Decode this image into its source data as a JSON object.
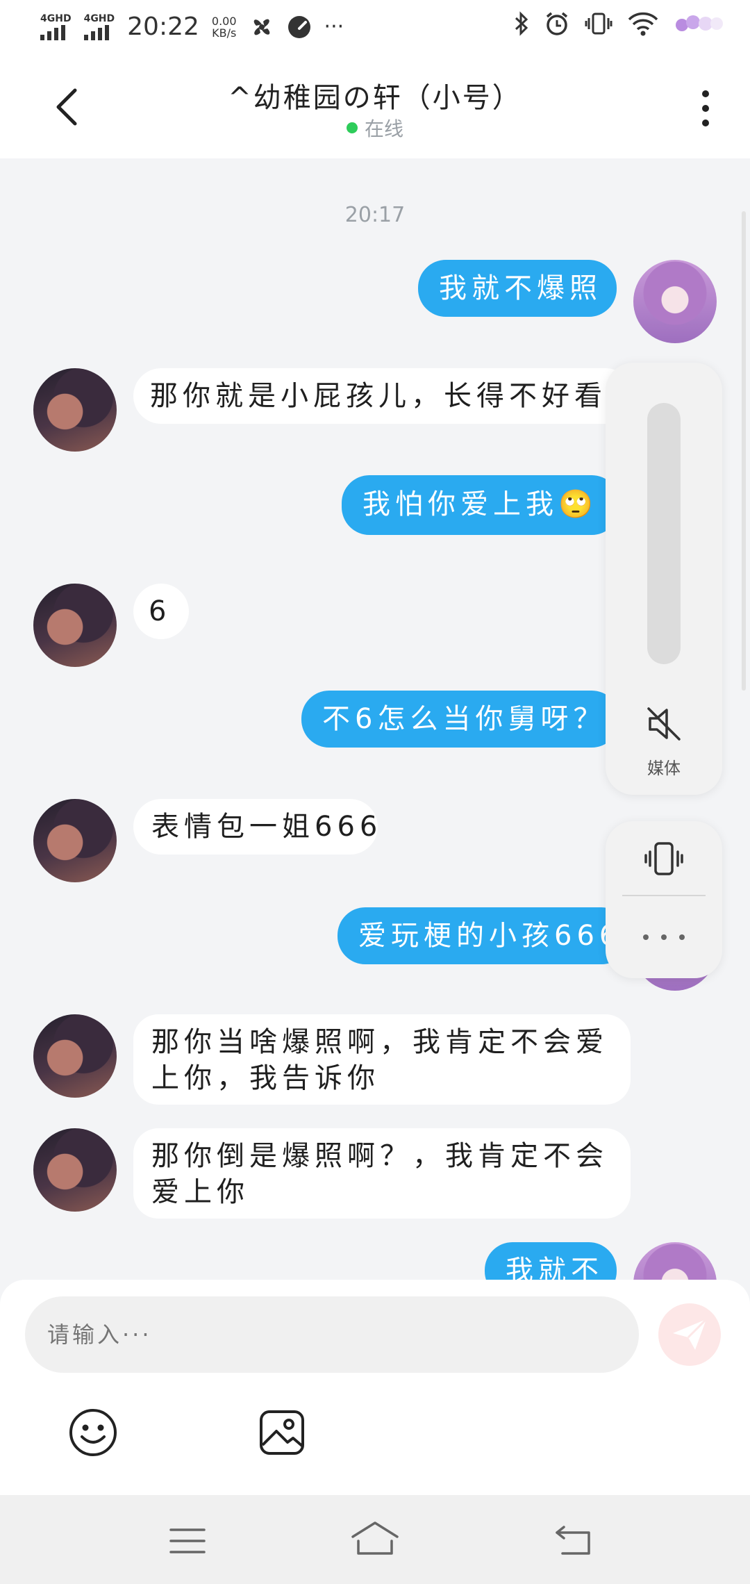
{
  "status_bar": {
    "net1": "4GHD",
    "net2": "4GHD",
    "time": "20:22",
    "speed_value": "0.00",
    "speed_unit": "KB/s",
    "more": "···",
    "icons": [
      "pinwheel-icon",
      "speedometer-icon",
      "bluetooth-icon",
      "alarm-icon",
      "vibrate-icon",
      "wifi-icon",
      "battery-icon"
    ]
  },
  "header": {
    "title": "^幼稚园の轩（小号）",
    "status": "在线",
    "status_color": "#2ecc5a"
  },
  "chat": {
    "timestamp": "20:17",
    "messages": [
      {
        "from": "me",
        "text": "我就不爆照"
      },
      {
        "from": "other",
        "text": "那你就是小屁孩儿，长得不好看"
      },
      {
        "from": "me",
        "text": "我怕你爱上我🙄"
      },
      {
        "from": "other",
        "text": "6"
      },
      {
        "from": "me",
        "text": "不6怎么当你舅呀？"
      },
      {
        "from": "other",
        "text": "表情包一姐666"
      },
      {
        "from": "me",
        "text": "爱玩梗的小孩666"
      },
      {
        "from": "other",
        "line1": "那你当啥爆照啊，我肯定不会爱",
        "line2": "上你，我告诉你"
      },
      {
        "from": "other",
        "line1": "那你倒是爆照啊？，我肯定不会",
        "line2": "爱上你"
      },
      {
        "from": "me",
        "text": "我就不"
      }
    ],
    "sent_color": "#2aaaf0"
  },
  "volume_panel": {
    "media_label": "媒体"
  },
  "composer": {
    "placeholder": "请输入···"
  },
  "navbar": {
    "icons": [
      "menu-icon",
      "home-icon",
      "back-icon"
    ]
  }
}
